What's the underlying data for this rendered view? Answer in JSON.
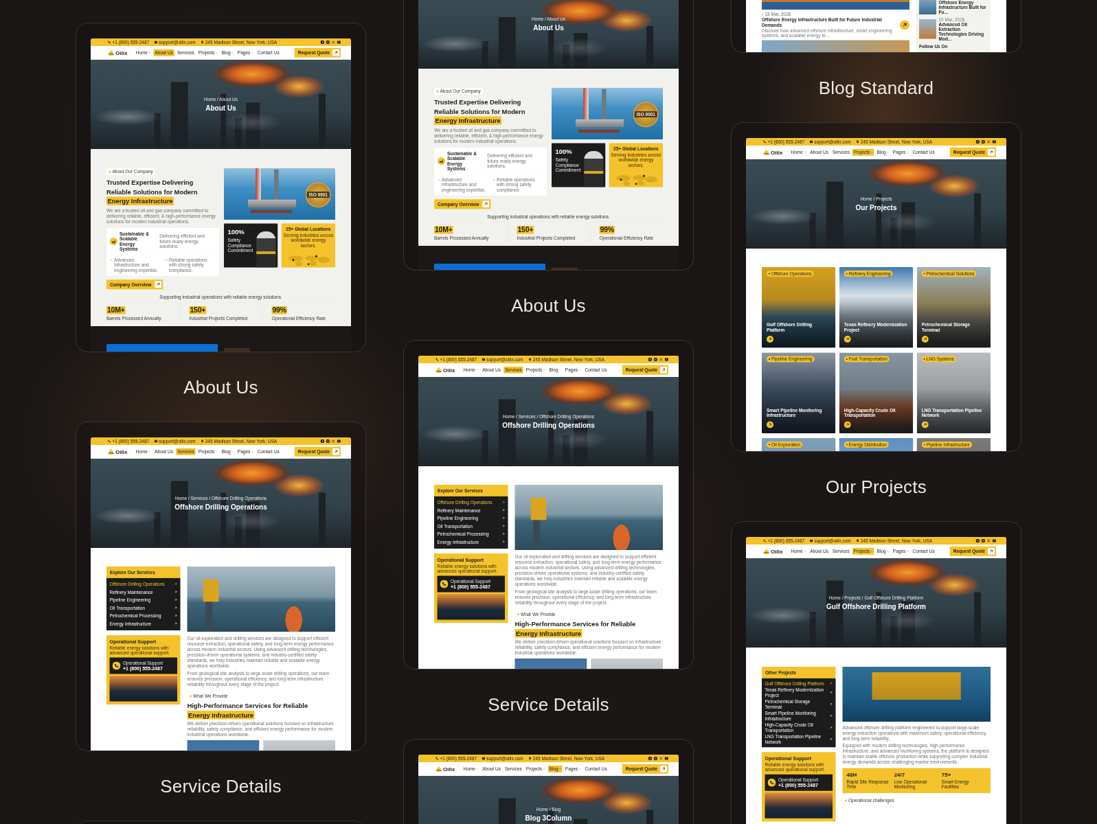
{
  "columns": [
    {
      "cards": [
        {
          "kind": "about",
          "label": "About Us",
          "page": {
            "header": {
              "topbar": {
                "phone": "+1 (800) 555-2487",
                "email": "support@oilix.com",
                "address": "245 Madison Street, New York, USA"
              },
              "logo": "Oilix",
              "nav": [
                {
                  "label": "Home",
                  "dropdown": true,
                  "selected": false
                },
                {
                  "label": "About Us",
                  "dropdown": false,
                  "selected": true
                },
                {
                  "label": "Services",
                  "dropdown": false,
                  "selected": false
                },
                {
                  "label": "Projects",
                  "dropdown": true,
                  "selected": false
                },
                {
                  "label": "Blog",
                  "dropdown": true,
                  "selected": false
                },
                {
                  "label": "Pages",
                  "dropdown": true,
                  "selected": false
                },
                {
                  "label": "Contact Us",
                  "dropdown": false,
                  "selected": false
                }
              ],
              "cta": "Request Quote"
            },
            "hero": {
              "breadcrumb": "Home / About Us",
              "title": "About Us"
            },
            "content": {
              "tag": "About Our Company",
              "heading": "Trusted Expertise Delivering Reliable Solutions for Modern",
              "highlight": "Energy Infrastructure",
              "intro": "We are a trusted oil and gas company committed to delivering reliable, efficient, & high-performance energy solutions for modern industrial operations.",
              "feature": {
                "title": "Sustainable & Scalable Energy Systems",
                "text": "Delivering efficient and future ready energy solutions."
              },
              "checks": [
                "Advanced infrastructure and engineering expertise.",
                "Reliable operations with strong safety compliance."
              ],
              "button": "Company Overview",
              "iso_badge": "ISO 9001",
              "safety": {
                "value": "100%",
                "label": "Safety Compliance Commitment"
              },
              "locations": {
                "title": "25+ Global Locations",
                "text": "Serving industries across worldwide energy sectors."
              },
              "tagline": "Supporting industrial operations with reliable energy solutions.",
              "stats": [
                {
                  "value": "10M+",
                  "label": "Barrels Processed Annually"
                },
                {
                  "value": "150+",
                  "label": "Industrial Projects Completed"
                },
                {
                  "value": "99%",
                  "label": "Operational Efficiency Rate"
                }
              ]
            }
          }
        },
        {
          "kind": "service",
          "label": "Service Details",
          "page": {
            "header": {
              "topbar": {
                "phone": "+1 (800) 555-2487",
                "email": "support@oilix.com",
                "address": "245 Madison Street, New York, USA"
              },
              "logo": "Oilix",
              "nav": [
                {
                  "label": "Home",
                  "dropdown": true,
                  "selected": false
                },
                {
                  "label": "About Us",
                  "dropdown": false,
                  "selected": false
                },
                {
                  "label": "Services",
                  "dropdown": false,
                  "selected": true
                },
                {
                  "label": "Projects",
                  "dropdown": true,
                  "selected": false
                },
                {
                  "label": "Blog",
                  "dropdown": true,
                  "selected": false
                },
                {
                  "label": "Pages",
                  "dropdown": true,
                  "selected": false
                },
                {
                  "label": "Contact Us",
                  "dropdown": false,
                  "selected": false
                }
              ],
              "cta": "Request Quote"
            },
            "hero": {
              "breadcrumb": "Home / Services / Offshore Drilling Operations",
              "title": "Offshore Drilling Operations"
            },
            "content": {
              "sidebar": {
                "title": "Explore Our Services",
                "items": [
                  {
                    "label": "Offshore Drilling Operations",
                    "selected": true
                  },
                  {
                    "label": "Refinery Maintenance",
                    "selected": false
                  },
                  {
                    "label": "Pipeline Engineering",
                    "selected": false
                  },
                  {
                    "label": "Oil Transportation",
                    "selected": false
                  },
                  {
                    "label": "Petrochemical Processing",
                    "selected": false
                  },
                  {
                    "label": "Energy Infrastructure",
                    "selected": false
                  }
                ]
              },
              "support": {
                "title": "Operational Support",
                "text": "Reliable energy solutions with advanced operational support.",
                "contact_label": "Operational Support",
                "phone": "+1 (800) 555-2487"
              },
              "paragraphs": [
                "Our oil exploration and drilling services are designed to support efficient resource extraction, operational safety, and long-term energy performance across modern industrial sectors. Using advanced drilling technologies, precision-driven operational systems, and industry-certified safety standards, we help industries maintain reliable and scalable energy operations worldwide.",
                "From geological site analysis to large-scale drilling operations, our team ensures precision, operational efficiency, and long-term infrastructure reliability throughout every stage of the project."
              ],
              "tag": "What We Provide",
              "heading": "High-Performance Services for Reliable",
              "highlight": "Energy Infrastructure",
              "intro": "We deliver precision-driven operational solutions focused on infrastructure reliability, safety compliance, and efficient energy performance for modern industrial operations worldwide."
            }
          }
        },
        {
          "kind": "blank"
        }
      ]
    },
    {
      "cards": [
        {
          "kind": "about",
          "label": "About Us",
          "page": {
            "hero": {
              "breadcrumb": "Home / About Us",
              "title": "About Us"
            },
            "content": {
              "tag": "About Our Company",
              "heading": "Trusted Expertise Delivering Reliable Solutions for Modern",
              "highlight": "Energy Infrastructure",
              "intro": "We are a trusted oil and gas company committed to delivering reliable, efficient, & high-performance energy solutions for modern industrial operations.",
              "feature": {
                "title": "Sustainable & Scalable Energy Systems",
                "text": "Delivering efficient and future ready energy solutions."
              },
              "checks": [
                "Advanced infrastructure and engineering expertise.",
                "Reliable operations with strong safety compliance."
              ],
              "button": "Company Overview",
              "iso_badge": "ISO 9001",
              "safety": {
                "value": "100%",
                "label": "Safety Compliance Commitment"
              },
              "locations": {
                "title": "25+ Global Locations",
                "text": "Serving industries across worldwide energy sectors."
              },
              "tagline": "Supporting industrial operations with reliable energy solutions.",
              "stats": [
                {
                  "value": "10M+",
                  "label": "Barrels Processed Annually"
                },
                {
                  "value": "150+",
                  "label": "Industrial Projects Completed"
                },
                {
                  "value": "99%",
                  "label": "Operational Efficiency Rate"
                }
              ]
            }
          }
        },
        {
          "kind": "service",
          "label": "Service Details",
          "page": {
            "header": {
              "topbar": {
                "phone": "+1 (800) 555-2487",
                "email": "support@oilix.com",
                "address": "245 Madison Street, New York, USA"
              },
              "logo": "Oilix",
              "nav": [
                {
                  "label": "Home",
                  "dropdown": true,
                  "selected": false
                },
                {
                  "label": "About Us",
                  "dropdown": false,
                  "selected": false
                },
                {
                  "label": "Services",
                  "dropdown": false,
                  "selected": true
                },
                {
                  "label": "Projects",
                  "dropdown": true,
                  "selected": false
                },
                {
                  "label": "Blog",
                  "dropdown": true,
                  "selected": false
                },
                {
                  "label": "Pages",
                  "dropdown": true,
                  "selected": false
                },
                {
                  "label": "Contact Us",
                  "dropdown": false,
                  "selected": false
                }
              ],
              "cta": "Request Quote"
            },
            "hero": {
              "breadcrumb": "Home / Services / Offshore Drilling Operations",
              "title": "Offshore Drilling Operations"
            },
            "content": {
              "sidebar": {
                "title": "Explore Our Services",
                "items": [
                  {
                    "label": "Offshore Drilling Operations",
                    "selected": true
                  },
                  {
                    "label": "Refinery Maintenance",
                    "selected": false
                  },
                  {
                    "label": "Pipeline Engineering",
                    "selected": false
                  },
                  {
                    "label": "Oil Transportation",
                    "selected": false
                  },
                  {
                    "label": "Petrochemical Processing",
                    "selected": false
                  },
                  {
                    "label": "Energy Infrastructure",
                    "selected": false
                  }
                ]
              },
              "support": {
                "title": "Operational Support",
                "text": "Reliable energy solutions with advanced operational support.",
                "contact_label": "Operational Support",
                "phone": "+1 (800) 555-2487"
              },
              "paragraphs": [
                "Our oil exploration and drilling services are designed to support efficient resource extraction, operational safety, and long-term energy performance across modern industrial sectors. Using advanced drilling technologies, precision-driven operational systems, and industry-certified safety standards, we help industries maintain reliable and scalable energy operations worldwide.",
                "From geological site analysis to large-scale drilling operations, our team ensures precision, operational efficiency, and long-term infrastructure reliability throughout every stage of the project."
              ],
              "tag": "What We Provide",
              "heading": "High-Performance Services for Reliable",
              "highlight": "Energy Infrastructure",
              "intro": "We deliver precision-driven operational solutions focused on infrastructure reliability, safety compliance, and efficient energy performance for modern industrial operations worldwide."
            }
          }
        },
        {
          "kind": "blog_grid",
          "page": {
            "header": {
              "topbar": {
                "phone": "+1 (800) 555-2487",
                "email": "support@oilix.com",
                "address": "245 Madison Street, New York, USA"
              },
              "logo": "Oilix",
              "nav": [
                {
                  "label": "Home",
                  "dropdown": true,
                  "selected": false
                },
                {
                  "label": "About Us",
                  "dropdown": false,
                  "selected": false
                },
                {
                  "label": "Services",
                  "dropdown": false,
                  "selected": false
                },
                {
                  "label": "Projects",
                  "dropdown": true,
                  "selected": false
                },
                {
                  "label": "Blog",
                  "dropdown": true,
                  "selected": true
                },
                {
                  "label": "Pages",
                  "dropdown": true,
                  "selected": false
                },
                {
                  "label": "Contact Us",
                  "dropdown": false,
                  "selected": false
                }
              ],
              "cta": "Request Quote"
            },
            "hero": {
              "breadcrumb": "Home / Blog",
              "title": "Blog 3Column"
            }
          }
        }
      ]
    },
    {
      "cards": [
        {
          "kind": "blog_standard",
          "label": "Blog Standard",
          "page": {
            "content": {
              "post": {
                "date": "15 Mar, 2026",
                "title": "Offshore Energy Infrastructure Built for Future Industrial Demands",
                "excerpt": "Discover how advanced offshore infrastructure, smart engineering systems, and scalable energy te..."
              },
              "recent": [
                {
                  "title": "Offshore Energy Infrastructure Built for Fu..."
                },
                {
                  "date": "10 Mar, 2026",
                  "title": "Advanced Oil Extraction Technologies Driving Mod..."
                }
              ],
              "follow": "Follow Us On"
            }
          }
        },
        {
          "kind": "projects",
          "label": "Our Projects",
          "page": {
            "header": {
              "topbar": {
                "phone": "+1 (800) 555-2487",
                "email": "support@oilix.com",
                "address": "245 Madison Street, New York, USA"
              },
              "logo": "Oilix",
              "nav": [
                {
                  "label": "Home",
                  "dropdown": true,
                  "selected": false
                },
                {
                  "label": "About Us",
                  "dropdown": false,
                  "selected": false
                },
                {
                  "label": "Services",
                  "dropdown": false,
                  "selected": false
                },
                {
                  "label": "Projects",
                  "dropdown": true,
                  "selected": true
                },
                {
                  "label": "Blog",
                  "dropdown": true,
                  "selected": false
                },
                {
                  "label": "Pages",
                  "dropdown": true,
                  "selected": false
                },
                {
                  "label": "Contact Us",
                  "dropdown": false,
                  "selected": false
                }
              ],
              "cta": "Request Quote"
            },
            "hero": {
              "breadcrumb": "Home / Projects",
              "title": "Our Projects"
            },
            "content": {
              "projects": [
                {
                  "tag": "Offshore Operations",
                  "title": "Gulf Offshore Drilling Platform"
                },
                {
                  "tag": "Refinery Engineering",
                  "title": "Texas Refinery Modernization Project"
                },
                {
                  "tag": "Petrochemical Solutions",
                  "title": "Petrochemical Storage Terminal"
                },
                {
                  "tag": "Pipeline Engineering",
                  "title": "Smart Pipeline Monitoring Infrastructure"
                },
                {
                  "tag": "Fuel Transportation",
                  "title": "High-Capacity Crude Oil Transportation"
                },
                {
                  "tag": "LNG Systems",
                  "title": "LNG Transportation Pipeline Network"
                },
                {
                  "tag": "Oil Exploration"
                },
                {
                  "tag": "Energy Distribution"
                },
                {
                  "tag": "Pipeline Infrastructure"
                }
              ]
            }
          }
        },
        {
          "kind": "project_detail",
          "page": {
            "header": {
              "topbar": {
                "phone": "+1 (800) 555-2487",
                "email": "support@oilix.com",
                "address": "245 Madison Street, New York, USA"
              },
              "logo": "Oilix",
              "nav": [
                {
                  "label": "Home",
                  "dropdown": true,
                  "selected": false
                },
                {
                  "label": "About Us",
                  "dropdown": false,
                  "selected": false
                },
                {
                  "label": "Services",
                  "dropdown": false,
                  "selected": false
                },
                {
                  "label": "Projects",
                  "dropdown": true,
                  "selected": true
                },
                {
                  "label": "Blog",
                  "dropdown": true,
                  "selected": false
                },
                {
                  "label": "Pages",
                  "dropdown": true,
                  "selected": false
                },
                {
                  "label": "Contact Us",
                  "dropdown": false,
                  "selected": false
                }
              ],
              "cta": "Request Quote"
            },
            "hero": {
              "breadcrumb": "Home / Projects / Gulf Offshore Drilling Platform",
              "title": "Gulf Offshore Drilling Platform"
            },
            "content": {
              "sidebar": {
                "title": "Other Projects",
                "items": [
                  {
                    "label": "Gulf Offshore Drilling Platform",
                    "selected": true
                  },
                  {
                    "label": "Texas Refinery Modernization Project",
                    "selected": false
                  },
                  {
                    "label": "Petrochemical Storage Terminal",
                    "selected": false
                  },
                  {
                    "label": "Smart Pipeline Monitoring Infrastructure",
                    "selected": false
                  },
                  {
                    "label": "High-Capacity Crude Oil Transportation",
                    "selected": false
                  },
                  {
                    "label": "LNG Transportation Pipeline Network",
                    "selected": false
                  }
                ]
              },
              "support": {
                "title": "Operational Support",
                "text": "Reliable energy solutions with advanced operational support.",
                "contact_label": "Operational Support",
                "phone": "+1 (800) 555-2487"
              },
              "paragraphs": [
                "Advanced offshore drilling platform engineered to support large-scale energy extraction operations with maximum safety, operational efficiency, and long-term reliability.",
                "Equipped with modern drilling technologies, high-performance infrastructure, and advanced monitoring systems, the platform is designed to maintain stable offshore production while supporting complex industrial energy demands across challenging marine environments."
              ],
              "stats": [
                {
                  "value": "48H",
                  "label": "Rapid Site Response Time"
                },
                {
                  "value": "24/7",
                  "label": "Live Operational Monitoring"
                },
                {
                  "value": "75+",
                  "label": "Smart Energy Facilities"
                }
              ],
              "tag": "Operational challenges"
            }
          }
        }
      ]
    }
  ]
}
